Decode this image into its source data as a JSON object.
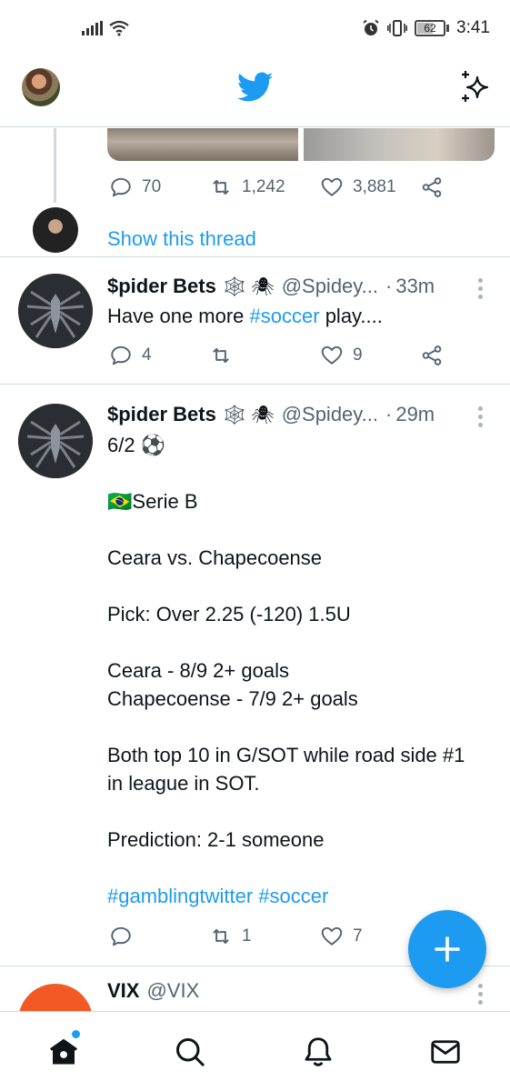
{
  "status_bar": {
    "time": "3:41",
    "battery": "62"
  },
  "header": {
    "icons": [
      "profile-avatar",
      "twitter-bird-icon",
      "sparkle-icon"
    ]
  },
  "thread_tail": {
    "replies": "70",
    "retweets": "1,242",
    "likes": "3,881",
    "show_thread": "Show this thread"
  },
  "tweets": [
    {
      "name": "$pider Bets",
      "emojis": "🕸️ 🕷",
      "handle": "@Spidey...",
      "dot": "·",
      "time": "33m",
      "text_plain": "Have one more ",
      "text_hashtag": "#soccer",
      "text_after": " play....",
      "replies": "4",
      "retweets": "",
      "likes": "9"
    },
    {
      "name": "$pider Bets",
      "emojis": "🕸️ 🕷",
      "handle": "@Spidey...",
      "dot": "·",
      "time": "29m",
      "lines": [
        "6/2 ⚽",
        "",
        "🇧🇷Serie B",
        "",
        "Ceara vs. Chapecoense",
        "",
        "Pick: Over 2.25 (-120) 1.5U",
        "",
        "Ceara - 8/9 2+ goals",
        "Chapecoense - 7/9 2+ goals",
        "",
        "Both top 10 in G/SOT while road side #1",
        "in league in SOT.",
        "",
        "Prediction: 2-1 someone",
        ""
      ],
      "hashtags": "#gamblingtwitter #soccer",
      "replies": "",
      "retweets": "1",
      "likes": "7"
    },
    {
      "name": "VIX",
      "handle": "@VIX"
    }
  ],
  "colors": {
    "accent": "#1d9bf0",
    "muted": "#536471",
    "divider": "#cfd9de"
  },
  "bottom_nav": [
    "home-icon",
    "search-icon",
    "notifications-icon",
    "messages-icon"
  ]
}
